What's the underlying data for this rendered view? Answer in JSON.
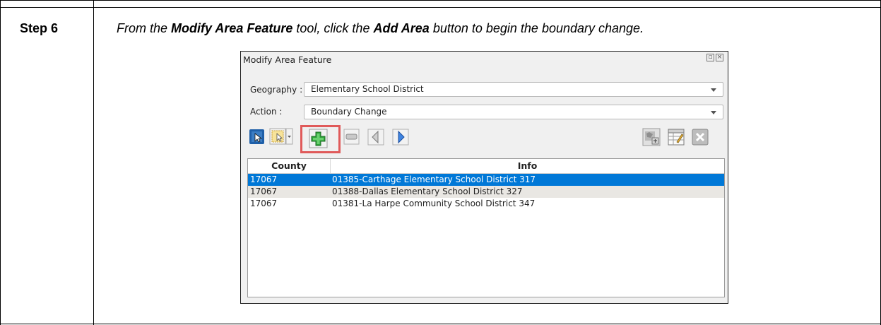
{
  "step": {
    "label": "Step 6",
    "instruction": {
      "p1": "From the ",
      "b1": "Modify Area Feature",
      "p2": " tool, click the ",
      "b2": "Add Area",
      "p3": " button to begin the boundary change."
    }
  },
  "dialog": {
    "title": "Modify Area Feature",
    "geography_label": "Geography :",
    "geography_value": "Elementary School District",
    "action_label": "Action :",
    "action_value": "Boundary Change",
    "columns": [
      "County",
      "Info"
    ],
    "rows": [
      {
        "county": "17067",
        "info": "01385-Carthage Elementary School District 317",
        "selected": true
      },
      {
        "county": "17067",
        "info": "01388-Dallas Elementary School District 327",
        "selected": false
      },
      {
        "county": "17067",
        "info": "01381-La Harpe Community School District 347",
        "selected": false
      }
    ]
  },
  "colors": {
    "selection": "#0078d7",
    "highlight_box": "#e05a5a",
    "add_icon_green": "#2fa33a"
  },
  "icons": [
    "select-tool-icon",
    "selection-dropdown-icon",
    "add-area-icon",
    "remove-area-icon",
    "previous-icon",
    "next-icon",
    "map-export-icon",
    "edit-table-icon",
    "close-x-icon"
  ]
}
